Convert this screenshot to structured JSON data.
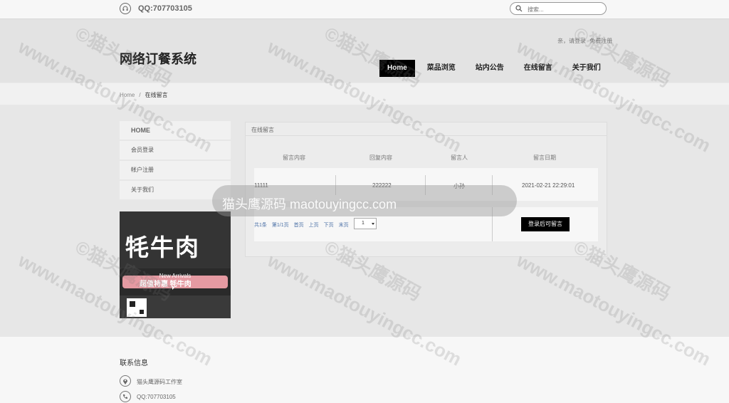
{
  "topbar": {
    "qq": "QQ:707703105",
    "search_placeholder": "搜索..."
  },
  "header": {
    "site_title": "网络订餐系统",
    "auth": {
      "greeting": "亲，请登录",
      "register": "免费注册"
    },
    "nav": [
      "Home",
      "菜品浏览",
      "站内公告",
      "在线留言",
      "关于我们"
    ],
    "active_nav": "Home"
  },
  "breadcrumb": {
    "home": "Home",
    "sep": "/",
    "current": "在线留言"
  },
  "sidebar": {
    "items": [
      "HOME",
      "会员登录",
      "帐户注册",
      "关于我们"
    ],
    "promo": {
      "headline": "牦牛肉",
      "tag": "New Arrivals",
      "sub": "超值特惠 牦牛肉"
    }
  },
  "panel": {
    "title": "在线留言",
    "headers": [
      "留言内容",
      "回复内容",
      "留言人",
      "留言日期"
    ],
    "rows": [
      {
        "content": "11111",
        "reply": "222222",
        "author": "小孙",
        "date": "2021-02-21 22:29:01"
      }
    ],
    "pager": {
      "total": "共1条",
      "page": "第1/1页",
      "first": "首页",
      "prev": "上页",
      "next": "下页",
      "last": "末页",
      "selected": "1"
    },
    "post_button": "登录后可留言"
  },
  "footer": {
    "title": "联系信息",
    "company": "猫头鹰源码工作室",
    "qq": "QQ:707703105"
  },
  "watermark": {
    "text_cn": "©猫头鹰源码",
    "text_en": "www.maotouyingcc.com",
    "banner": "猫头鹰源码 maotouyingcc.com"
  }
}
